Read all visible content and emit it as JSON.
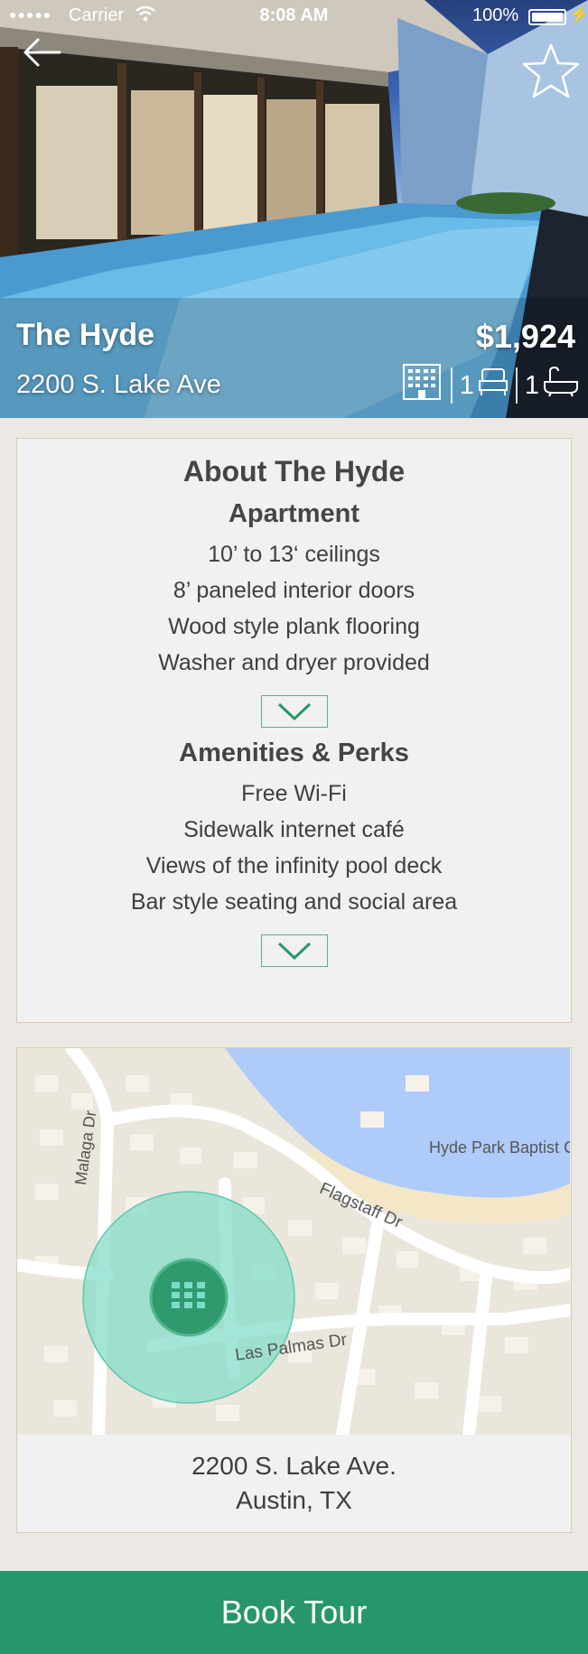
{
  "status_bar": {
    "signal": "●●●●●",
    "carrier": "Carrier",
    "time": "8:08 AM",
    "battery": "100%"
  },
  "property": {
    "name": "The Hyde",
    "address": "2200 S. Lake Ave",
    "price": "$1,924",
    "bedrooms": "1",
    "bathrooms": "1"
  },
  "about": {
    "title": "About The Hyde",
    "apartment": {
      "title": "Apartment",
      "items": [
        "10’ to 13‘ ceilings",
        "8’ paneled interior doors",
        "Wood style plank flooring",
        "Washer and dryer provided"
      ]
    },
    "amenities": {
      "title": "Amenities & Perks",
      "items": [
        "Free Wi-Fi",
        "Sidewalk internet café",
        "Views of the infinity pool deck",
        "Bar style seating and social area"
      ]
    }
  },
  "map": {
    "streets": {
      "malaga": "Malaga Dr",
      "flagstaff": "Flagstaff Dr",
      "las_palmas": "Las Palmas Dr"
    },
    "poi": "Hyde Park Baptist C",
    "address_line1": "2200 S. Lake Ave.",
    "address_line2": "Austin, TX"
  },
  "actions": {
    "book_tour": "Book Tour"
  },
  "colors": {
    "accent": "#27966a",
    "card_border": "#dcc9b3",
    "map_radius": "#7fdcc8",
    "water": "#aecbfa"
  }
}
